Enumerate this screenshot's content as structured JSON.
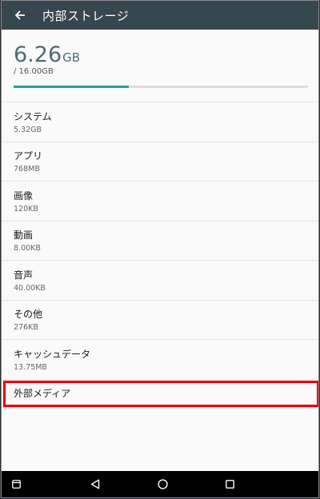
{
  "appbar": {
    "title": "内部ストレージ",
    "back_icon": "arrow-left-icon"
  },
  "summary": {
    "used_value": "6.26",
    "used_unit": "GB",
    "total_text": "/ 16.00GB",
    "usage_fraction": 0.39,
    "accent_color": "#27a08e",
    "value_color": "#4e6b76"
  },
  "categories": [
    {
      "name": "システム",
      "size": "5.32GB"
    },
    {
      "name": "アプリ",
      "size": "768MB"
    },
    {
      "name": "画像",
      "size": "120KB"
    },
    {
      "name": "動画",
      "size": "8.00KB"
    },
    {
      "name": "音声",
      "size": "40.00KB"
    },
    {
      "name": "その他",
      "size": "276KB"
    },
    {
      "name": "キャッシュデータ",
      "size": "13.75MB"
    }
  ],
  "external_media": {
    "label": "外部メディア",
    "highlight_color": "#e8000b"
  },
  "navbar": {
    "icons": [
      "window-icon",
      "back-triangle-icon",
      "home-circle-icon",
      "recents-square-icon"
    ]
  }
}
